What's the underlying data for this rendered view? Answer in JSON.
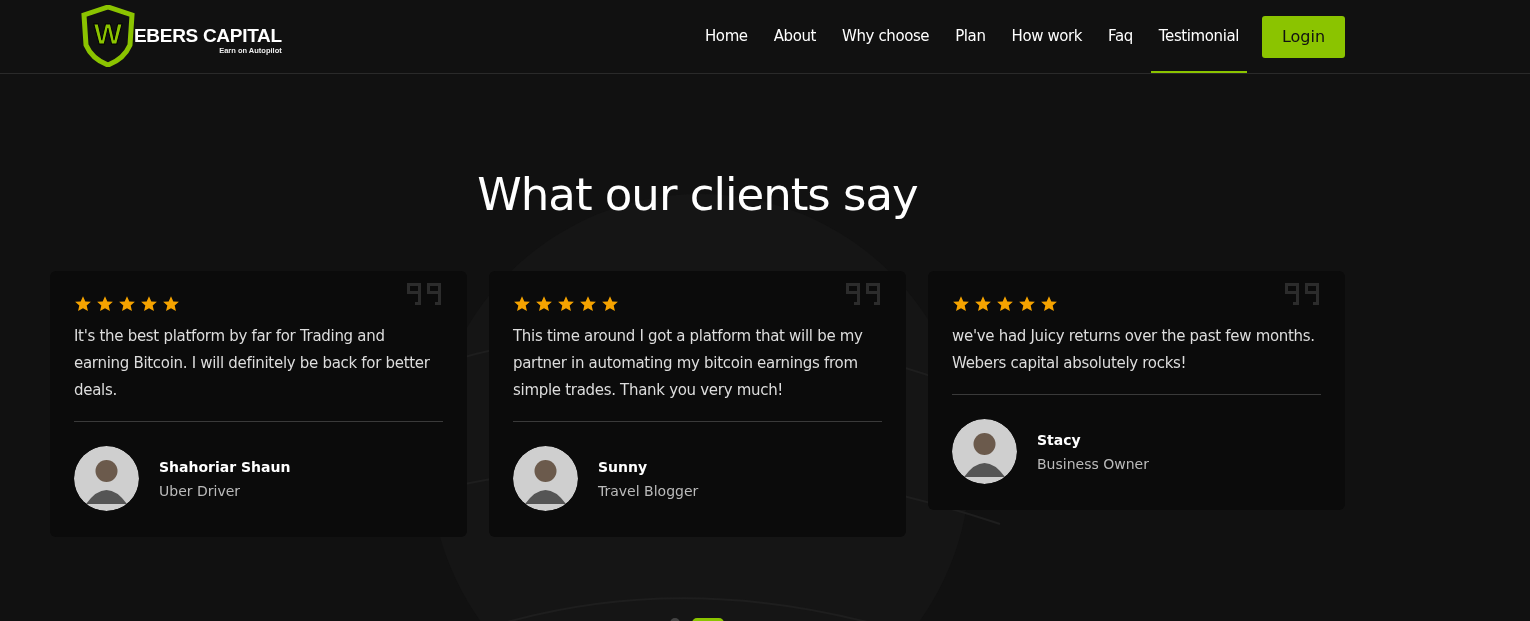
{
  "header": {
    "logo": {
      "letter": "W",
      "name": "EBERS CAPITAL",
      "tagline": "Earn on Autopilot"
    },
    "nav": [
      {
        "label": "Home",
        "selected": false
      },
      {
        "label": "About",
        "selected": false
      },
      {
        "label": "Why choose",
        "selected": false
      },
      {
        "label": "Plan",
        "selected": false
      },
      {
        "label": "How work",
        "selected": false
      },
      {
        "label": "Faq",
        "selected": false
      },
      {
        "label": "Testimonial",
        "selected": true
      }
    ],
    "login_button": "Login"
  },
  "section": {
    "title": "What our clients say",
    "testimonials": [
      {
        "stars": 5,
        "quote": "It's the best platform by far for Trading and earning Bitcoin. I will definitely be back for better deals.",
        "name": "Shahoriar Shaun",
        "role": "Uber Driver"
      },
      {
        "stars": 5,
        "quote": "This time around I got a platform that will be my partner in automating my bitcoin earnings from simple trades. Thank you very much!",
        "name": "Sunny",
        "role": "Travel Blogger"
      },
      {
        "stars": 5,
        "quote": "we've had Juicy returns over the past few months. Webers capital absolutely rocks!",
        "name": "Stacy",
        "role": "Business Owner"
      }
    ],
    "carousel_dots": [
      {
        "selected": false
      },
      {
        "selected": true
      }
    ]
  }
}
